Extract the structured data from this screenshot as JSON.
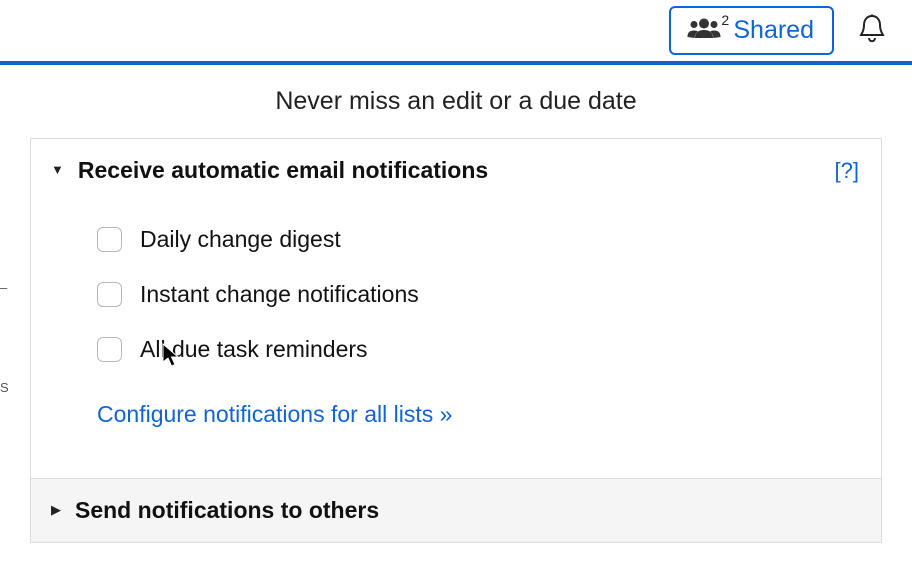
{
  "topbar": {
    "shared_count": "2",
    "shared_label": "Shared"
  },
  "panel": {
    "title": "Never miss an edit or a due date"
  },
  "section_receive": {
    "title": "Receive automatic email notifications",
    "help": "[?]",
    "options": [
      {
        "label": "Daily change digest"
      },
      {
        "label": "Instant change notifications"
      },
      {
        "label": "All due task reminders"
      }
    ],
    "config_link": "Configure notifications for all lists »"
  },
  "section_send": {
    "title": "Send notifications to others"
  }
}
